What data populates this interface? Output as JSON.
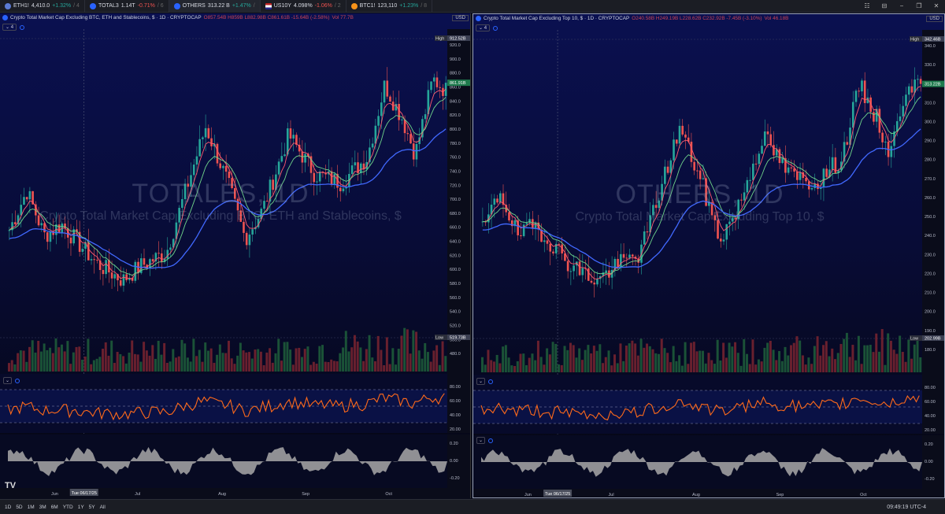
{
  "tabs": [
    {
      "label": "ETH1!",
      "price": "4,410.0",
      "change": "+1.32%",
      "extra": "/ 4",
      "color": "#5b7bd5",
      "dir": "up"
    },
    {
      "label": "TOTAL3",
      "price": "1.14T",
      "change": "-0.71%",
      "extra": "/ 6",
      "color": "#2962ff",
      "dir": "dn"
    },
    {
      "label": "OTHERS",
      "price": "313.22 B",
      "change": "+1.47%",
      "extra": "/",
      "color": "#2962ff",
      "dir": "up"
    },
    {
      "label": "US10Y",
      "price": "4.098%",
      "change": "-1.06%",
      "extra": "/ 2",
      "color": "flag",
      "dir": "dn"
    },
    {
      "label": "BTC1!",
      "price": "123,110",
      "change": "+1.23%",
      "extra": "/ 8",
      "color": "#f7931a",
      "dir": "up"
    }
  ],
  "window_controls": [
    "☷",
    "⊟",
    "−",
    "❐",
    "✕"
  ],
  "left": {
    "title": "Crypto Total Market Cap Excluding BTC, ETH and Stablecoins, $ · 1D · CRYPTOCAP",
    "ohlc": "O857.54B H859B L882.98B C861.61B -15.64B (-2.58%)",
    "vol": "Vol 77.7B",
    "indicator_count": "4",
    "currency": "USD",
    "watermark_symbol": "TOTALES, 1D",
    "watermark_desc": "Crypto Total Market Cap Excluding BTC, ETH and Stablecoins, $",
    "price_labels": [
      "920.0",
      "900.0",
      "880.0",
      "860.0",
      "840.0",
      "820.0",
      "800.0",
      "780.0",
      "760.0",
      "740.0",
      "720.0",
      "700.0",
      "680.0",
      "660.0",
      "640.0",
      "620.0",
      "600.0",
      "580.0",
      "560.0",
      "540.0",
      "520.0",
      "500.0",
      "480.0"
    ],
    "high_label": "High",
    "high_value": "912.52B",
    "last_value": "861.91B",
    "low_label": "Low",
    "low_value": "519.73B",
    "rsi_labels": [
      "80.00",
      "60.00",
      "40.00",
      "20.00"
    ],
    "osc_labels": [
      "0.20",
      "0.00",
      "-0.20"
    ],
    "x_labels": [
      "Jun",
      "Jul",
      "Aug",
      "Sep",
      "Oct"
    ],
    "cross_date": "Tue 06/17/25"
  },
  "right": {
    "title": "Crypto Total Market Cap Excluding Top 10, $ · 1D · CRYPTOCAP",
    "ohlc": "O240.58B H249.19B L228.62B C232.92B -7.45B (-3.10%)",
    "vol": "Vol 46.18B",
    "indicator_count": "4",
    "currency": "USD",
    "watermark_symbol": "OTHERS, 1D",
    "watermark_desc": "Crypto Total Market Cap Excluding Top 10, $",
    "price_labels": [
      "340.0",
      "330.0",
      "320.0",
      "310.0",
      "300.0",
      "290.0",
      "280.0",
      "270.0",
      "260.0",
      "250.0",
      "240.0",
      "230.0",
      "220.0",
      "210.0",
      "200.0",
      "190.0",
      "180.0"
    ],
    "high_label": "High",
    "high_value": "342.46B",
    "last_value": "313.22B",
    "low_label": "Low",
    "low_value": "202.99B",
    "rsi_labels": [
      "80.00",
      "60.00",
      "40.00",
      "20.00"
    ],
    "osc_labels": [
      "0.20",
      "0.00",
      "-0.20"
    ],
    "x_labels": [
      "Jun",
      "Jul",
      "Aug",
      "Sep",
      "Oct"
    ],
    "cross_date": "Tue 06/17/25"
  },
  "bottombar": {
    "timeframes": [
      "1D",
      "5D",
      "1M",
      "3M",
      "6M",
      "YTD",
      "1Y",
      "5Y",
      "All"
    ],
    "clock": "09:49:19 UTC-4"
  },
  "logo": "TV",
  "colors": {
    "up": "#26a69a",
    "down": "#ef5350",
    "ema_red": "#ff5a6e",
    "ema_green": "#6fd38a",
    "ma_blue": "#4169ff",
    "rsi": "#ff6a1a",
    "osc": "#a8a8a8",
    "bg_top": "#0a1050"
  }
}
